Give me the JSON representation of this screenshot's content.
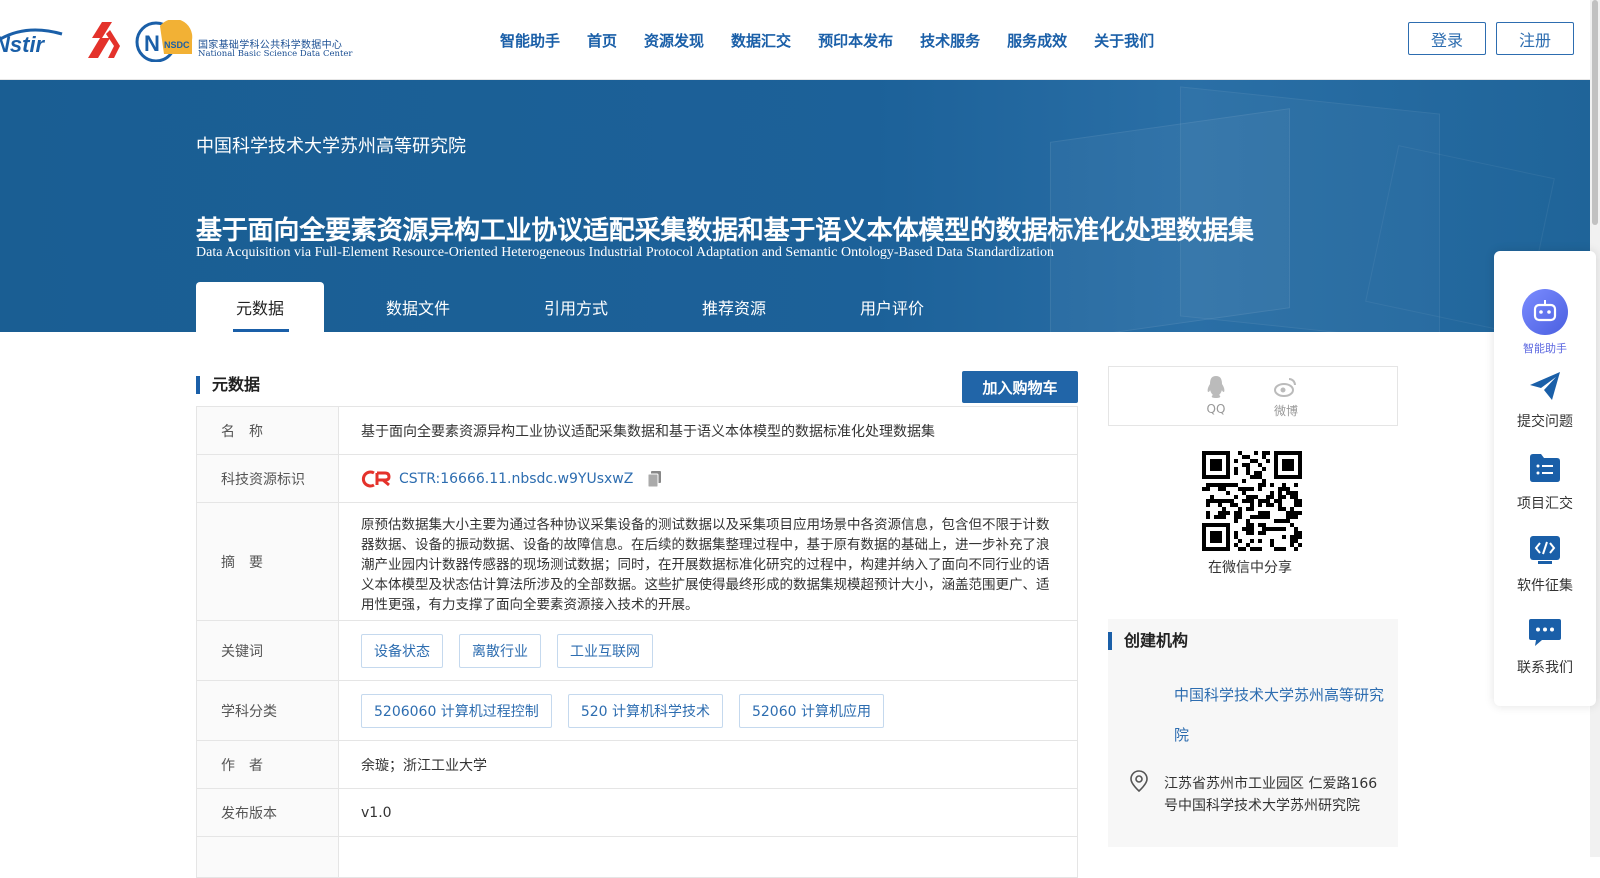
{
  "header": {
    "logos": {
      "cstr": "Nstir",
      "nsdc_badge": "NSDC",
      "nsdc_name_cn": "国家基础学科公共科学数据中心",
      "nsdc_name_en": "National Basic Science Data Center"
    },
    "nav": [
      "智能助手",
      "首页",
      "资源发现",
      "数据汇交",
      "预印本发布",
      "技术服务",
      "服务成效",
      "关于我们"
    ],
    "login_label": "登录",
    "register_label": "注册"
  },
  "banner": {
    "org": "中国科学技术大学苏州高等研究院",
    "title_cn": "基于面向全要素资源异构工业协议适配采集数据和基于语义本体模型的数据标准化处理数据集",
    "title_en": "Data Acquisition via Full-Element Resource-Oriented Heterogeneous Industrial Protocol Adaptation and Semantic Ontology-Based Data Standardization",
    "tabs": [
      "元数据",
      "数据文件",
      "引用方式",
      "推荐资源",
      "用户评价"
    ],
    "active_tab": 0
  },
  "metadata": {
    "section_title": "元数据",
    "cart_label": "加入购物车",
    "rows": {
      "name": {
        "label": "名　称",
        "value": "基于面向全要素资源异构工业协议适配采集数据和基于语义本体模型的数据标准化处理数据集"
      },
      "identifier": {
        "label": "科技资源标识",
        "value": "CSTR:16666.11.nbsdc.w9YUsxwZ"
      },
      "abstract": {
        "label": "摘　要",
        "value": "原预估数据集大小主要为通过各种协议采集设备的测试数据以及采集项目应用场景中各资源信息，包含但不限于计数器数据、设备的振动数据、设备的故障信息。在后续的数据集整理过程中，基于原有数据的基础上，进一步补充了浪潮产业园内计数器传感器的现场测试数据；同时，在开展数据标准化研究的过程中，构建并纳入了面向不同行业的语义本体模型及状态估计算法所涉及的全部数据。这些扩展使得最终形成的数据集规模超预计大小，涵盖范围更广、适用性更强，有力支撑了面向全要素资源接入技术的开展。"
      },
      "keywords": {
        "label": "关键词",
        "tags": [
          "设备状态",
          "离散行业",
          "工业互联网"
        ]
      },
      "subjects": {
        "label": "学科分类",
        "tags": [
          "5206060 计算机过程控制",
          "520 计算机科学技术",
          "52060 计算机应用"
        ]
      },
      "authors": {
        "label": "作　者",
        "value": "余璇；浙江工业大学"
      },
      "version": {
        "label": "发布版本",
        "value": "v1.0"
      }
    }
  },
  "share": {
    "qq_label": "QQ",
    "weibo_label": "微博",
    "qr_caption": "在微信中分享"
  },
  "creator": {
    "title": "创建机构",
    "name": "中国科学技术大学苏州高等研究院",
    "address": "江苏省苏州市工业园区 仁爱路166号中国科学技术大学苏州研究院"
  },
  "float_bar": {
    "items": [
      "智能助手",
      "提交问题",
      "项目汇交",
      "软件征集",
      "联系我们"
    ]
  },
  "colors": {
    "primary": "#1a5fa8",
    "banner": "#1c6199",
    "accent_red": "#e4322b"
  }
}
